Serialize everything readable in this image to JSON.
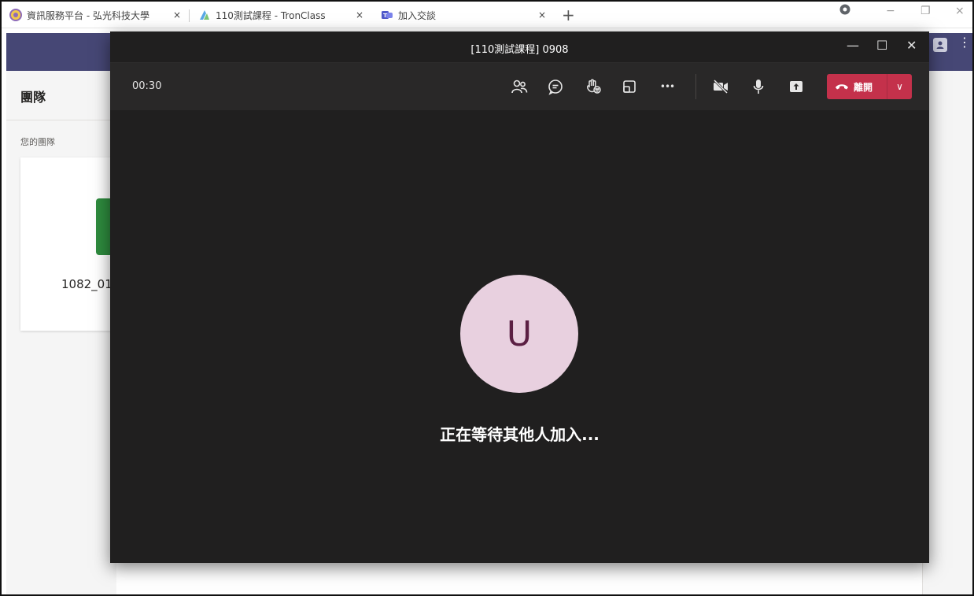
{
  "browser": {
    "tabs": [
      {
        "title": "資訊服務平台 - 弘光科技大學",
        "close": "×"
      },
      {
        "title": "110測試課程 - TronClass",
        "close": "×"
      },
      {
        "title": "加入交談",
        "close": "×"
      }
    ],
    "new_tab": "+",
    "window_controls": {
      "minimize": "−",
      "restore": "❐",
      "close": "×"
    }
  },
  "teams": {
    "section_title": "團隊",
    "your_teams_label": "您的團隊",
    "team_card_name": "1082_01",
    "menu_glyph": "⋮",
    "header_color": "#464775"
  },
  "call": {
    "title": "[110測試課程] 0908",
    "window_controls": {
      "minimize": "—",
      "maximize": "☐",
      "close": "✕"
    },
    "timer": "00:30",
    "toolbar_icons": [
      "people-icon",
      "chat-icon",
      "raise-hand-icon",
      "rooms-icon",
      "more-icon",
      "camera-off-icon",
      "microphone-icon",
      "share-screen-icon"
    ],
    "more_glyph": "•••",
    "leave_label": "離開",
    "leave_caret": "∨",
    "leave_color": "#c4314b",
    "avatar_initial": "U",
    "avatar_bg": "#e8d0df",
    "waiting_text": "正在等待其他人加入..."
  }
}
